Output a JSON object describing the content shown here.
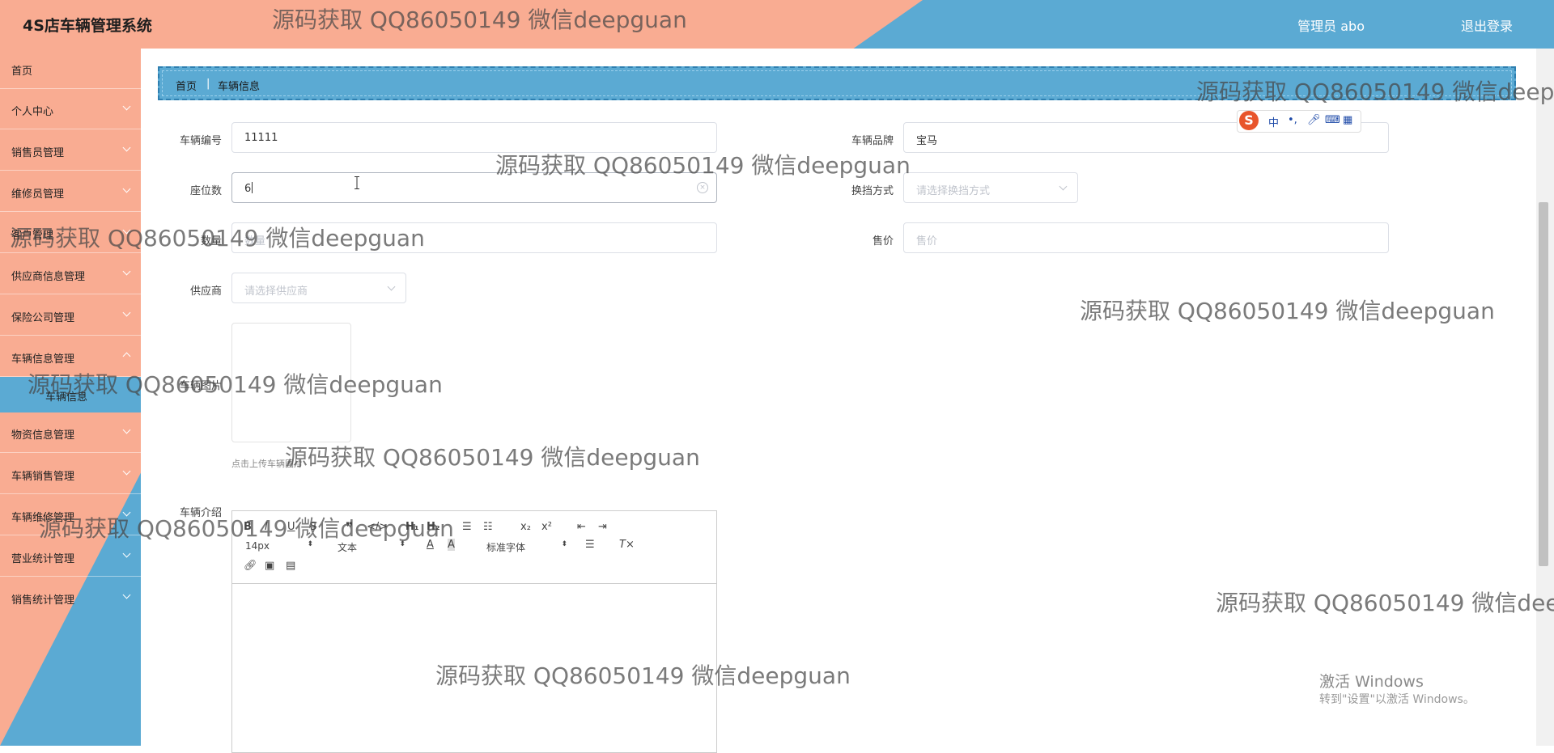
{
  "header": {
    "app_title": "4S店车辆管理系统",
    "user_label": "管理员 abo",
    "logout_label": "退出登录"
  },
  "sidebar": {
    "items": [
      {
        "label": "首页"
      },
      {
        "label": "个人中心"
      },
      {
        "label": "销售员管理"
      },
      {
        "label": "维修员管理"
      },
      {
        "label": "客户管理"
      },
      {
        "label": "供应商信息管理"
      },
      {
        "label": "保险公司管理"
      },
      {
        "label": "车辆信息管理"
      },
      {
        "label": "物资信息管理"
      },
      {
        "label": "车辆销售管理"
      },
      {
        "label": "车辆维修管理"
      },
      {
        "label": "营业统计管理"
      },
      {
        "label": "销售统计管理"
      }
    ],
    "active_sub": "车辆信息"
  },
  "breadcrumb": {
    "home": "首页",
    "separator": "|",
    "current": "车辆信息"
  },
  "form": {
    "vehicle_no": {
      "label": "车辆编号",
      "value": "11111"
    },
    "brand": {
      "label": "车辆品牌",
      "value": "宝马"
    },
    "seats": {
      "label": "座位数",
      "value": "6"
    },
    "transmission": {
      "label": "换挡方式",
      "placeholder": "请选择换挡方式"
    },
    "quantity": {
      "label": "数量",
      "placeholder": "数量"
    },
    "price": {
      "label": "售价",
      "placeholder": "售价"
    },
    "supplier": {
      "label": "供应商",
      "placeholder": "请选择供应商"
    },
    "image": {
      "label": "车辆图片",
      "tip": "点击上传车辆图片"
    },
    "intro": {
      "label": "车辆介绍"
    }
  },
  "editor": {
    "font_size": "14px",
    "block_type": "文本",
    "font_family": "标准字体"
  },
  "ime": {
    "mode": "中"
  },
  "watermark": "源码获取 QQ86050149 微信deepguan",
  "windows_activation": {
    "title": "激活 Windows",
    "subtitle": "转到\"设置\"以激活 Windows。"
  }
}
